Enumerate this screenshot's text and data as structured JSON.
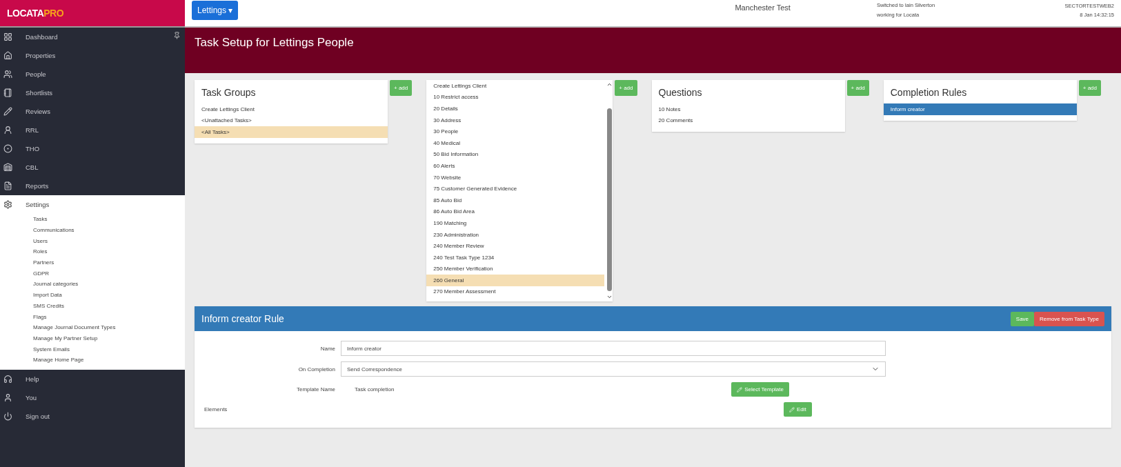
{
  "logo": {
    "main": "LOCATA",
    "accent": "PRO"
  },
  "nav": [
    {
      "label": "Dashboard",
      "expanded": false
    },
    {
      "label": "Properties",
      "expanded": false
    },
    {
      "label": "People",
      "expanded": false
    },
    {
      "label": "Shortlists",
      "expanded": false
    },
    {
      "label": "Reviews",
      "expanded": false
    },
    {
      "label": "RRL",
      "expanded": false
    },
    {
      "label": "THO",
      "expanded": false
    },
    {
      "label": "CBL",
      "expanded": false
    },
    {
      "label": "Reports",
      "expanded": false
    },
    {
      "label": "Settings",
      "expanded": true,
      "children": [
        "Tasks",
        "Communications",
        "Users",
        "Roles",
        "Partners",
        "GDPR",
        "Journal categories",
        "Import Data",
        "SMS Credits",
        "Flags",
        "Manage Journal Document Types",
        "Manage My Partner Setup",
        "System Emails",
        "Manage Home Page"
      ]
    },
    {
      "label": "Help",
      "expanded": false
    },
    {
      "label": "You",
      "expanded": false
    },
    {
      "label": "Sign out",
      "expanded": false
    }
  ],
  "header": {
    "module_button": "Lettings",
    "module_caret": "▾",
    "org": "Manchester Test",
    "switched_line1": "Switched to Iain Silverton",
    "switched_line2": "working for Locata",
    "server": "SECTORTESTWEB2",
    "datetime": "8 Jan 14:32:15"
  },
  "page_title": "Task Setup for Lettings People",
  "task_groups": {
    "title": "Task Groups",
    "add": "+ add",
    "items": [
      {
        "label": "Create Lettings Client",
        "selected": false
      },
      {
        "label": "<Unattached Tasks>",
        "selected": false
      },
      {
        "label": "<All Tasks>",
        "selected": true
      }
    ]
  },
  "task_types": {
    "add": "+ add",
    "items": [
      {
        "label": "Create Lettings Client",
        "selected": false
      },
      {
        "label": "10 Restrict access",
        "selected": false
      },
      {
        "label": "20 Details",
        "selected": false
      },
      {
        "label": "30 Address",
        "selected": false
      },
      {
        "label": "30 People",
        "selected": false
      },
      {
        "label": "40 Medical",
        "selected": false
      },
      {
        "label": "50 Bid Information",
        "selected": false
      },
      {
        "label": "60 Alerts",
        "selected": false
      },
      {
        "label": "70 Website",
        "selected": false
      },
      {
        "label": "75 Customer Generated Evidence",
        "selected": false
      },
      {
        "label": "85 Auto Bid",
        "selected": false
      },
      {
        "label": "86 Auto Bid Area",
        "selected": false
      },
      {
        "label": "190 Matching",
        "selected": false
      },
      {
        "label": "230 Administration",
        "selected": false
      },
      {
        "label": "240 Member Review",
        "selected": false
      },
      {
        "label": "240 Test Task Type 1234",
        "selected": false
      },
      {
        "label": "250 Member Verification",
        "selected": false
      },
      {
        "label": "260 General",
        "selected": true
      },
      {
        "label": "270 Member Assessment",
        "selected": false
      }
    ]
  },
  "questions": {
    "title": "Questions",
    "add": "+ add",
    "items": [
      {
        "label": "10 Notes",
        "selected": false
      },
      {
        "label": "20 Comments",
        "selected": false
      }
    ]
  },
  "completion_rules": {
    "title": "Completion Rules",
    "add": "+ add",
    "items": [
      {
        "label": "Inform creator",
        "selected": true
      }
    ]
  },
  "rule": {
    "title": "Inform creator Rule",
    "save": "Save",
    "remove": "Remove from Task Type",
    "name_label": "Name",
    "name_value": "Inform creator",
    "on_completion_label": "On Completion",
    "on_completion_value": "Send Correspondence",
    "template_label": "Template Name",
    "template_value": "Task completion",
    "select_template": "Select Template",
    "elements_label": "Elements",
    "edit": "Edit"
  }
}
